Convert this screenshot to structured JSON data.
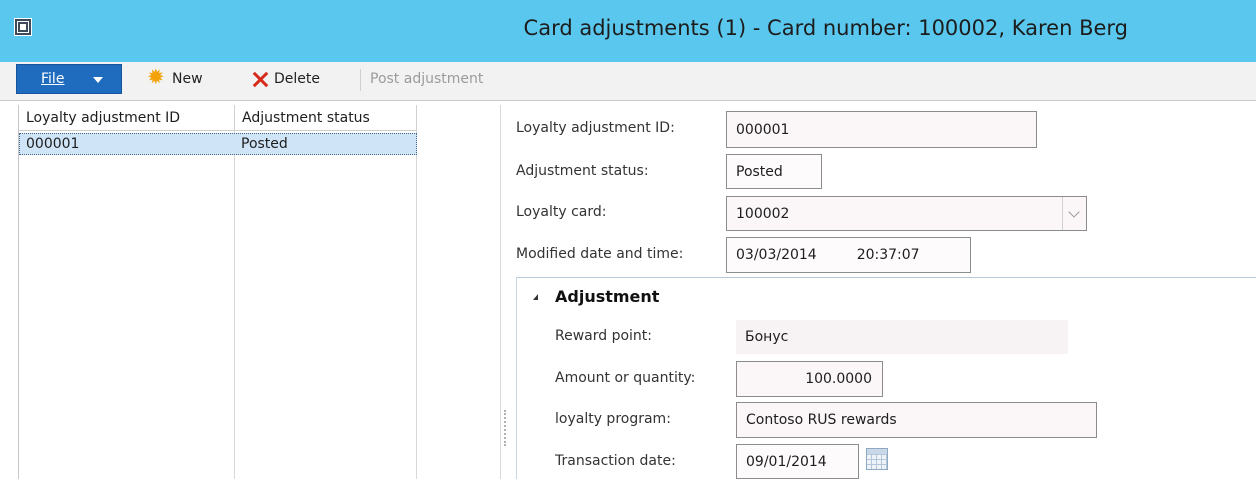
{
  "window": {
    "title": "Card adjustments (1) - Card number: 100002, Karen Berg"
  },
  "toolbar": {
    "file_label": "File",
    "new_label": "New",
    "delete_label": "Delete",
    "post_label": "Post adjustment"
  },
  "grid": {
    "columns": [
      "Loyalty adjustment ID",
      "Adjustment status"
    ],
    "rows": [
      {
        "id": "000001",
        "status": "Posted"
      }
    ]
  },
  "form": {
    "loyalty_adjustment_id": {
      "label": "Loyalty adjustment ID:",
      "value": "000001"
    },
    "adjustment_status": {
      "label": "Adjustment status:",
      "value": "Posted"
    },
    "loyalty_card": {
      "label": "Loyalty card:",
      "value": "100002"
    },
    "modified": {
      "label": "Modified date and time:",
      "date": "03/03/2014",
      "time": "20:37:07"
    }
  },
  "adjustment": {
    "title": "Adjustment",
    "reward_point": {
      "label": "Reward point:",
      "value": "Бонус"
    },
    "amount": {
      "label": "Amount or quantity:",
      "value": "100.0000"
    },
    "program": {
      "label": "loyalty program:",
      "value": "Contoso RUS rewards"
    },
    "transaction_date": {
      "label": "Transaction date:",
      "value": "09/01/2014"
    }
  },
  "colors": {
    "titlebar": "#5ac8ee",
    "file_button": "#1f6cbf",
    "selected_row": "#cfe4f7"
  }
}
